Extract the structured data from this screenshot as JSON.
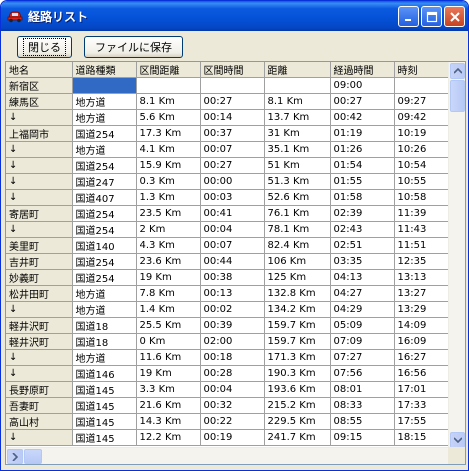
{
  "window": {
    "title": "経路リスト",
    "icon": "red-car-icon",
    "minimize_icon": "minimize-icon",
    "maximize_icon": "maximize-icon",
    "close_icon": "close-icon"
  },
  "toolbar": {
    "close_label": "閉じる",
    "save_label": "ファイルに保存"
  },
  "table": {
    "columns": [
      "地名",
      "道路種類",
      "区間距離",
      "区間時間",
      "距離",
      "経過時間",
      "時刻"
    ],
    "selected_row": 0,
    "rows": [
      [
        "新宿区",
        "",
        "",
        "",
        "",
        "09:00",
        ""
      ],
      [
        "練馬区",
        "地方道",
        "8.1 Km",
        "00:27",
        "8.1 Km",
        "00:27",
        "09:27"
      ],
      [
        "↓",
        "地方道",
        "5.6 Km",
        "00:14",
        "13.7 Km",
        "00:42",
        "09:42"
      ],
      [
        "上福岡市",
        "国道254",
        "17.3 Km",
        "00:37",
        "31 Km",
        "01:19",
        "10:19"
      ],
      [
        "↓",
        "地方道",
        "4.1 Km",
        "00:07",
        "35.1 Km",
        "01:26",
        "10:26"
      ],
      [
        "↓",
        "国道254",
        "15.9 Km",
        "00:27",
        "51 Km",
        "01:54",
        "10:54"
      ],
      [
        "↓",
        "国道247",
        "0.3 Km",
        "00:00",
        "51.3 Km",
        "01:55",
        "10:55"
      ],
      [
        "↓",
        "国道407",
        "1.3 Km",
        "00:03",
        "52.6 Km",
        "01:58",
        "10:58"
      ],
      [
        "寄居町",
        "国道254",
        "23.5 Km",
        "00:41",
        "76.1 Km",
        "02:39",
        "11:39"
      ],
      [
        "↓",
        "国道254",
        "2 Km",
        "00:04",
        "78.1 Km",
        "02:43",
        "11:43"
      ],
      [
        "美里町",
        "国道140",
        "4.3 Km",
        "00:07",
        "82.4 Km",
        "02:51",
        "11:51"
      ],
      [
        "吉井町",
        "国道254",
        "23.6 Km",
        "00:44",
        "106 Km",
        "03:35",
        "12:35"
      ],
      [
        "妙義町",
        "国道254",
        "19 Km",
        "00:38",
        "125 Km",
        "04:13",
        "13:13"
      ],
      [
        "松井田町",
        "地方道",
        "7.8 Km",
        "00:13",
        "132.8 Km",
        "04:27",
        "13:27"
      ],
      [
        "↓",
        "地方道",
        "1.4 Km",
        "00:02",
        "134.2 Km",
        "04:29",
        "13:29"
      ],
      [
        "軽井沢町",
        "国道18",
        "25.5 Km",
        "00:39",
        "159.7 Km",
        "05:09",
        "14:09"
      ],
      [
        "軽井沢町",
        "国道18",
        "0 Km",
        "02:00",
        "159.7 Km",
        "07:09",
        "16:09"
      ],
      [
        "↓",
        "地方道",
        "11.6 Km",
        "00:18",
        "171.3 Km",
        "07:27",
        "16:27"
      ],
      [
        "↓",
        "国道146",
        "19 Km",
        "00:28",
        "190.3 Km",
        "07:56",
        "16:56"
      ],
      [
        "長野原町",
        "国道145",
        "3.3 Km",
        "00:04",
        "193.6 Km",
        "08:01",
        "17:01"
      ],
      [
        "吾妻町",
        "国道145",
        "21.6 Km",
        "00:32",
        "215.2 Km",
        "08:33",
        "17:33"
      ],
      [
        "高山村",
        "国道145",
        "14.3 Km",
        "00:22",
        "229.5 Km",
        "08:55",
        "17:55"
      ],
      [
        "↓",
        "国道145",
        "12.2 Km",
        "00:19",
        "241.7 Km",
        "09:15",
        "18:15"
      ]
    ]
  },
  "scrollbars": {
    "up_icon": "scroll-up-arrow-icon",
    "down_icon": "scroll-down-arrow-icon",
    "left_icon": "scroll-left-arrow-icon",
    "right_icon": "scroll-right-arrow-icon"
  }
}
